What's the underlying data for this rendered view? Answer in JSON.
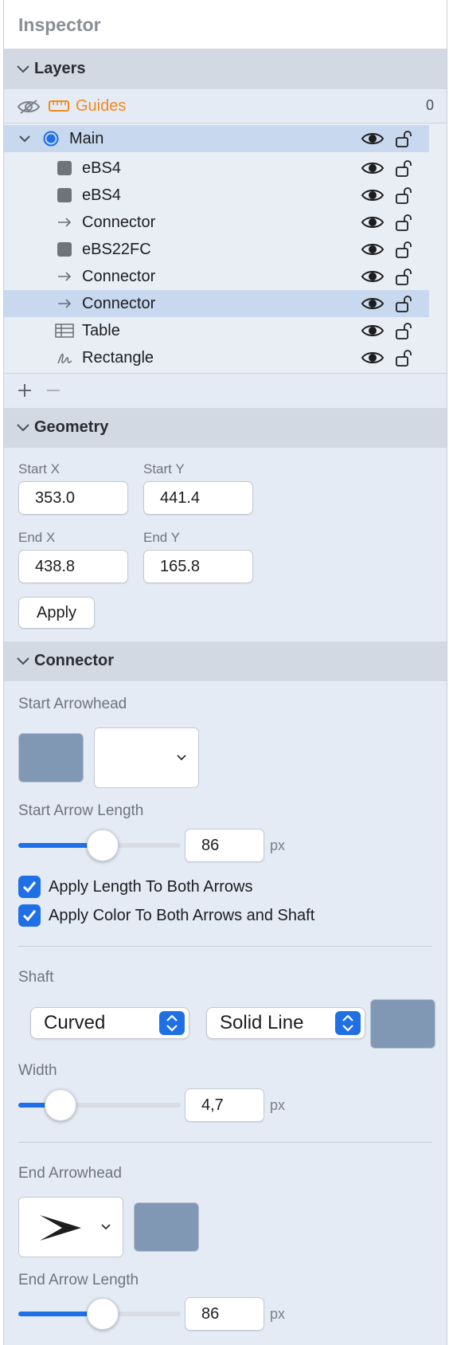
{
  "inspector": {
    "title": "Inspector"
  },
  "layers": {
    "header": "Layers",
    "guides": {
      "label": "Guides",
      "count": "0"
    },
    "items": [
      {
        "name": "Main",
        "icon": "layer-dot-icon"
      },
      {
        "name": "eBS4",
        "icon": "square-shape-icon"
      },
      {
        "name": "eBS4",
        "icon": "square-shape-icon"
      },
      {
        "name": "Connector",
        "icon": "arrow-right-icon"
      },
      {
        "name": "eBS22FC",
        "icon": "square-shape-icon"
      },
      {
        "name": "Connector",
        "icon": "arrow-right-icon"
      },
      {
        "name": "Connector",
        "icon": "arrow-right-icon"
      },
      {
        "name": "Table",
        "icon": "table-icon"
      },
      {
        "name": "Rectangle",
        "icon": "freehand-icon"
      }
    ]
  },
  "geometry": {
    "header": "Geometry",
    "start_x_label": "Start X",
    "start_x": "353.0",
    "start_y_label": "Start Y",
    "start_y": "441.4",
    "end_x_label": "End X",
    "end_x": "438.8",
    "end_y_label": "End Y",
    "end_y": "165.8",
    "apply_label": "Apply"
  },
  "connector": {
    "header": "Connector",
    "start_arrowhead_label": "Start Arrowhead",
    "start_arrow_length_label": "Start Arrow Length",
    "start_arrow_length": "86",
    "start_arrow_length_fraction": 0.52,
    "unit": "px",
    "apply_length_both": "Apply Length To Both Arrows",
    "apply_color_all": "Apply Color To Both Arrows and Shaft",
    "shaft_label": "Shaft",
    "shaft_style": "Curved",
    "line_style": "Solid Line",
    "width_label": "Width",
    "width_value": "4,7",
    "width_fraction": 0.26,
    "end_arrowhead_label": "End Arrowhead",
    "end_arrow_length_label": "End Arrow Length",
    "end_arrow_length": "86",
    "end_arrow_length_fraction": 0.52,
    "color": "#8098b4",
    "accent": "#1f6fe6"
  }
}
